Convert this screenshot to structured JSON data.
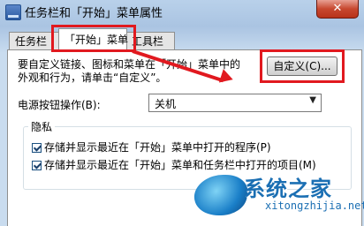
{
  "window": {
    "title": "任务栏和「开始」菜单属性",
    "close_glyph": "✕"
  },
  "tabs": [
    {
      "label": "任务栏"
    },
    {
      "label": "「开始」菜单"
    },
    {
      "label": "工具栏"
    }
  ],
  "start_menu_tab": {
    "description": "要自定义链接、图标和菜单在「开始」菜单中的外观和行为，请单击“自定义”。",
    "customize_button": "自定义(C)...",
    "power_button_label": "电源按钮操作(B):",
    "power_button_value": "关机",
    "privacy": {
      "title": "隐私",
      "option1": "存储并显示最近在「开始」菜单中打开的程序(P)",
      "option2": "存储并显示最近在「开始」菜单和任务栏中打开的项目(M)"
    }
  },
  "annotation": {
    "color": "#e1191f"
  },
  "watermark": {
    "site_name": "系统之家",
    "url": "xitongzhijia.net"
  }
}
